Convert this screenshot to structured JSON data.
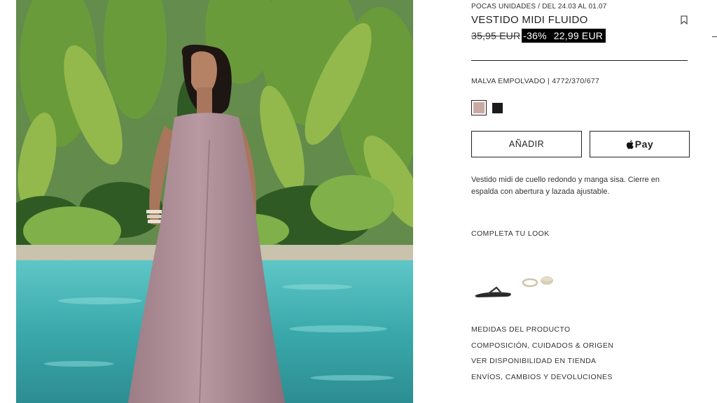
{
  "product": {
    "stock_notice": "POCAS UNIDADES / DEL 24.03 AL 01.07",
    "title": "VESTIDO MIDI FLUIDO",
    "price_original": "35,95 EUR",
    "discount": "-36%",
    "price_sale": "22,99 EUR",
    "color_reference": "MALVA EMPOLVADO | 4772/370/677",
    "colors": [
      {
        "name": "malva-empolvado",
        "hex": "#c8aaa3",
        "selected": true
      },
      {
        "name": "negro",
        "hex": "#1b1b1b",
        "selected": false
      }
    ],
    "description": "Vestido midi de cuello redondo y manga sisa. Cierre en espalda con abertura y lazada ajustable."
  },
  "actions": {
    "add_label": "AÑADIR",
    "apple_pay_label": "Pay"
  },
  "look": {
    "title": "COMPLETA TU LOOK",
    "items": [
      "sandal",
      "bracelets"
    ]
  },
  "info_links": [
    "MEDIDAS DEL PRODUCTO",
    "COMPOSICIÓN, CUIDADOS & ORIGEN",
    "VER DISPONIBILIDAD EN TIENDA",
    "ENVÍOS, CAMBIOS Y DEVOLUCIONES"
  ],
  "icons": {
    "bookmark": "bookmark-icon",
    "apple": "apple-logo-icon"
  },
  "colors": {
    "text": "#222222",
    "sale_bg": "#000000",
    "sale_text": "#ffffff"
  }
}
